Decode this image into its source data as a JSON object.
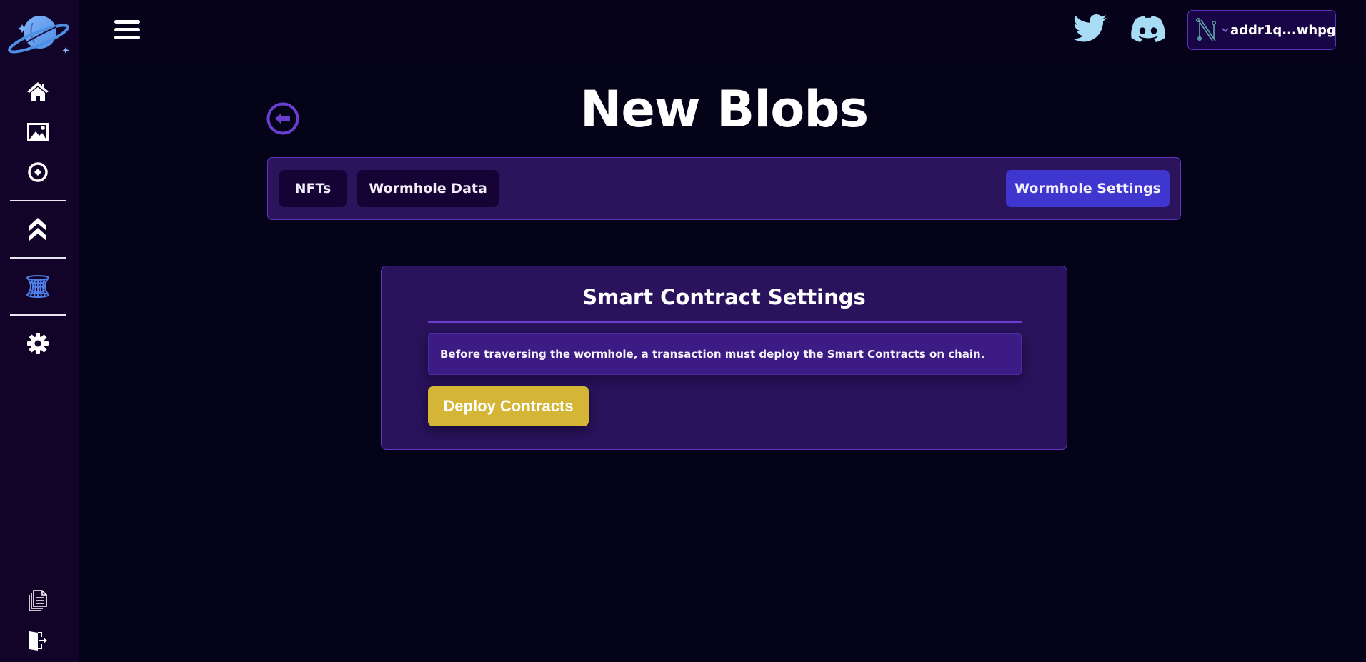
{
  "app": {
    "logo": "planet-logo"
  },
  "sidebar": {
    "items": [
      {
        "id": "home",
        "icon": "home-icon"
      },
      {
        "id": "gallery",
        "icon": "image-icon"
      },
      {
        "id": "mint",
        "icon": "circle-dot-icon"
      },
      {
        "id": "upgrade",
        "icon": "double-chevron-up-icon"
      },
      {
        "id": "wormhole",
        "icon": "wormhole-icon",
        "active": true,
        "color": "#4f7ee8"
      },
      {
        "id": "settings",
        "icon": "gear-icon"
      },
      {
        "id": "docs",
        "icon": "documents-icon"
      },
      {
        "id": "logout",
        "icon": "logout-icon"
      }
    ]
  },
  "topbar": {
    "menu_icon": "hamburger-icon",
    "social": [
      {
        "id": "twitter",
        "icon": "twitter-icon",
        "color": "#a8dcf5"
      },
      {
        "id": "discord",
        "icon": "discord-icon",
        "color": "#a8dcf5"
      }
    ],
    "wallet": {
      "network_icon": "nami-n-icon",
      "address": "addr1q...whpg"
    }
  },
  "page": {
    "title": "New Blobs",
    "back_icon": "arrow-left-circle-icon"
  },
  "tabs": [
    {
      "label": "NFTs",
      "active": false
    },
    {
      "label": "Wormhole Data",
      "active": false
    },
    {
      "label": "Wormhole Settings",
      "active": true
    }
  ],
  "card": {
    "title": "Smart Contract Settings",
    "notice": "Before traversing the wormhole, a transaction must deploy the Smart Contracts on chain.",
    "deploy_label": "Deploy Contracts"
  },
  "colors": {
    "accent": "#3f36d0",
    "deploy": "#d4b535",
    "border": "#5d35c0",
    "background": "#050317",
    "panel": "#2a135c"
  }
}
